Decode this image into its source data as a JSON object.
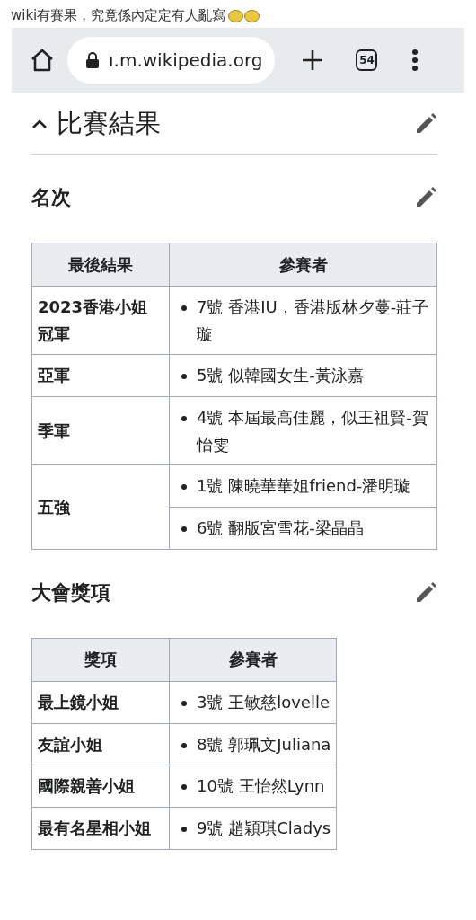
{
  "caption": {
    "text": "wiki有賽果，究竟係內定定有人亂寫"
  },
  "browser": {
    "url": "ı.m.wikipedia.org",
    "tab_count": "54"
  },
  "section": {
    "title": "比賽結果",
    "expanded": true
  },
  "subsections": [
    {
      "title": "名次",
      "table": {
        "columns": [
          "最後結果",
          "參賽者"
        ],
        "rows": [
          {
            "label": "2023香港小姐冠軍",
            "entries": [
              "7號 香港IU，香港版林夕蔓-莊子璇"
            ]
          },
          {
            "label": "亞軍",
            "entries": [
              "5號 似韓國女生-黃泳嘉"
            ]
          },
          {
            "label": "季軍",
            "entries": [
              "4號 本屆最高佳麗，似王祖賢-賀怡雯"
            ]
          },
          {
            "label": "五強",
            "entries": [
              "1號 陳曉華華姐friend-潘明璇",
              "6號 翻版宮雪花-梁晶晶"
            ]
          }
        ]
      }
    },
    {
      "title": "大會獎項",
      "table": {
        "columns": [
          "獎項",
          "參賽者"
        ],
        "rows": [
          {
            "label": "最上鏡小姐",
            "entries": [
              "3號 王敏慈lovelle"
            ]
          },
          {
            "label": "友誼小姐",
            "entries": [
              "8號 郭珮文Juliana"
            ]
          },
          {
            "label": "國際親善小姐",
            "entries": [
              "10號 王怡然Lynn"
            ]
          },
          {
            "label": "最有名星相小姐",
            "entries": [
              "9號 趙穎琪Cladys"
            ]
          }
        ]
      }
    }
  ]
}
